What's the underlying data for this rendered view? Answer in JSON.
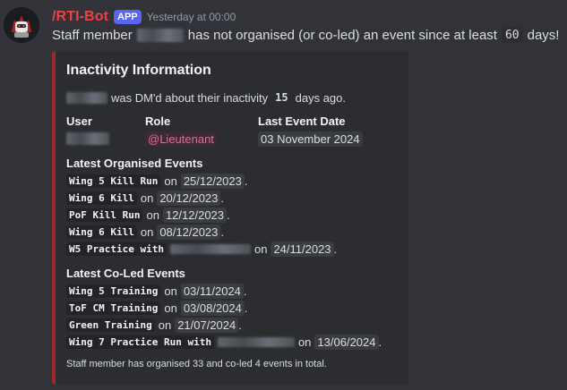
{
  "message": {
    "bot_name": "/RTI-Bot",
    "badge": "APP",
    "timestamp": "Yesterday at 00:00",
    "text_before": "Staff member",
    "text_middle": "has not organised (or co-led) an event since at least",
    "days_threshold": "60",
    "text_after": "days!"
  },
  "embed": {
    "accent_color": "#a12828",
    "title": "Inactivity Information",
    "dm_text_a": "was DM'd about their inactivity",
    "dm_days": "15",
    "dm_text_b": "days ago.",
    "fields": {
      "user_label": "User",
      "role_label": "Role",
      "role_value": "@Lieutenant",
      "last_event_label": "Last Event Date",
      "last_event_value": "03 November 2024"
    },
    "organised_heading": "Latest Organised Events",
    "organised_events": [
      {
        "name": "Wing 5 Kill Run",
        "on": "on",
        "date": "25/12/2023",
        "end": "."
      },
      {
        "name": "Wing 6 Kill",
        "on": "on",
        "date": "20/12/2023",
        "end": "."
      },
      {
        "name": "PoF Kill Run",
        "on": "on",
        "date": "12/12/2023",
        "end": "."
      },
      {
        "name": "Wing 6 Kill",
        "on": "on",
        "date": "08/12/2023",
        "end": "."
      },
      {
        "name": "W5 Practice with",
        "on": "on",
        "date": "24/11/2023",
        "end": "."
      }
    ],
    "coled_heading": "Latest Co-Led Events",
    "coled_events": [
      {
        "name": "Wing 5 Training",
        "on": "on",
        "date": "03/11/2024",
        "end": "."
      },
      {
        "name": "ToF CM Training",
        "on": "on",
        "date": "03/08/2024",
        "end": "."
      },
      {
        "name": "Green Training",
        "on": "on",
        "date": "21/07/2024",
        "end": "."
      },
      {
        "name": "Wing 7 Practice Run with",
        "on": "on",
        "date": "13/06/2024",
        "end": "."
      }
    ],
    "footer": "Staff member has organised 33 and co-led 4 events in total."
  }
}
